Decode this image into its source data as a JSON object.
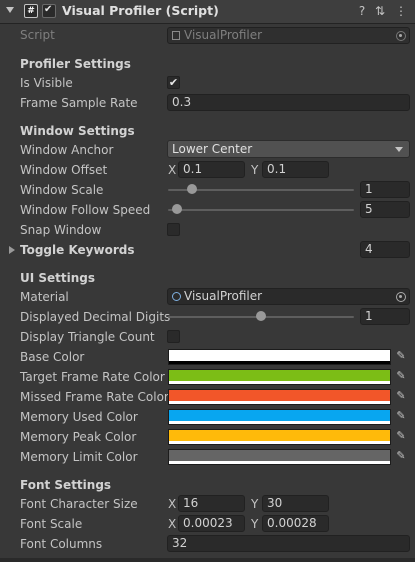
{
  "header": {
    "title": "Visual Profiler (Script)",
    "script_icon_text": "#",
    "enabled_check": "✔",
    "help_icon": "?",
    "settings_icon": "⇅",
    "menu_icon": "⋮"
  },
  "script": {
    "label": "Script",
    "value": "VisualProfiler"
  },
  "profiler_settings": {
    "title": "Profiler Settings",
    "is_visible_label": "Is Visible",
    "is_visible_check": "✔",
    "frame_sample_rate_label": "Frame Sample Rate",
    "frame_sample_rate_value": "0.3"
  },
  "window_settings": {
    "title": "Window Settings",
    "anchor_label": "Window Anchor",
    "anchor_value": "Lower Center",
    "offset_label": "Window Offset",
    "offset_x_label": "X",
    "offset_x": "0.1",
    "offset_y_label": "Y",
    "offset_y": "0.1",
    "scale_label": "Window Scale",
    "scale_value": "1",
    "scale_level": 0.13,
    "follow_speed_label": "Window Follow Speed",
    "follow_speed_value": "5",
    "follow_speed_level": 0.05,
    "snap_label": "Snap Window"
  },
  "toggle_keywords": {
    "label": "Toggle Keywords",
    "count": "4"
  },
  "ui_settings": {
    "title": "UI Settings",
    "material_label": "Material",
    "material_value": "VisualProfiler",
    "decimal_label": "Displayed Decimal Digits",
    "decimal_value": "1",
    "decimal_level": 0.5,
    "triangle_label": "Display Triangle Count",
    "colors": [
      {
        "label": "Base Color",
        "color": "#ffffff",
        "alpha_bar": false
      },
      {
        "label": "Target Frame Rate Color",
        "color": "#7cbd16",
        "alpha_bar": true
      },
      {
        "label": "Missed Frame Rate Color",
        "color": "#f25629",
        "alpha_bar": true
      },
      {
        "label": "Memory Used Color",
        "color": "#08a6f0",
        "alpha_bar": true
      },
      {
        "label": "Memory Peak Color",
        "color": "#ffba0a",
        "alpha_bar": true
      },
      {
        "label": "Memory Limit Color",
        "color": "#656565",
        "alpha_bar": true
      }
    ]
  },
  "font_settings": {
    "title": "Font Settings",
    "char_size_label": "Font Character Size",
    "char_size_x": "16",
    "char_size_y": "30",
    "scale_label": "Font Scale",
    "scale_x": "0.00023",
    "scale_y": "0.00028",
    "columns_label": "Font Columns",
    "columns_value": "32",
    "x_label": "X",
    "y_label": "Y"
  }
}
